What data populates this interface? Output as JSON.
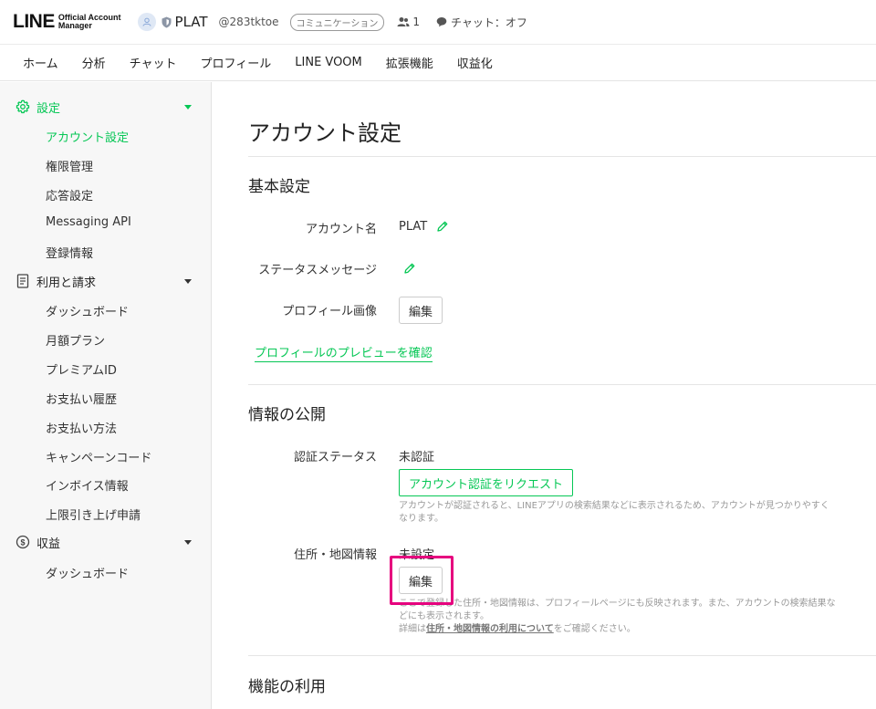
{
  "header": {
    "logo_text": "LINE",
    "logo_sub_line1": "Official Account",
    "logo_sub_line2": "Manager",
    "account_name": "PLAT",
    "account_id": "@283tktoe",
    "account_type_badge": "コミュニケーション",
    "friend_count": "1",
    "chat_status": "チャット：オフ"
  },
  "nav": {
    "items": [
      "ホーム",
      "分析",
      "チャット",
      "プロフィール",
      "LINE VOOM",
      "拡張機能",
      "収益化"
    ]
  },
  "sidebar": {
    "sections": [
      {
        "label": "設定",
        "icon": "gear-icon",
        "items": [
          "アカウント設定",
          "権限管理",
          "応答設定",
          "Messaging API",
          "登録情報"
        ]
      },
      {
        "label": "利用と請求",
        "icon": "document-icon",
        "items": [
          "ダッシュボード",
          "月額プラン",
          "プレミアムID",
          "お支払い履歴",
          "お支払い方法",
          "キャンペーンコード",
          "インボイス情報",
          "上限引き上げ申請"
        ]
      },
      {
        "label": "収益",
        "icon": "coin-icon",
        "items": [
          "ダッシュボード"
        ]
      }
    ]
  },
  "main": {
    "page_title": "アカウント設定",
    "basic": {
      "title": "基本設定",
      "account_name_label": "アカウント名",
      "account_name_value": "PLAT",
      "status_message_label": "ステータスメッセージ",
      "profile_image_label": "プロフィール画像",
      "profile_image_button": "編集",
      "preview_link": "プロフィールのプレビューを確認"
    },
    "publish": {
      "title": "情報の公開",
      "verify_label": "認証ステータス",
      "verify_value": "未認証",
      "verify_button": "アカウント認証をリクエスト",
      "verify_help": "アカウントが認証されると、LINEアプリの検索結果などに表示されるため、アカウントが見つかりやすくなります。",
      "address_label": "住所・地図情報",
      "address_value": "未設定",
      "address_button": "編集",
      "address_help": "ここで登録した住所・地図情報は、プロフィールページにも反映されます。また、アカウントの検索結果などにも表示されます。",
      "address_help2_prefix": "詳細は",
      "address_help2_link": "住所・地図情報の利用について",
      "address_help2_suffix": "をご確認ください。"
    },
    "features": {
      "title": "機能の利用"
    }
  },
  "colors": {
    "accent": "#06c755",
    "highlight": "#e6007e"
  }
}
